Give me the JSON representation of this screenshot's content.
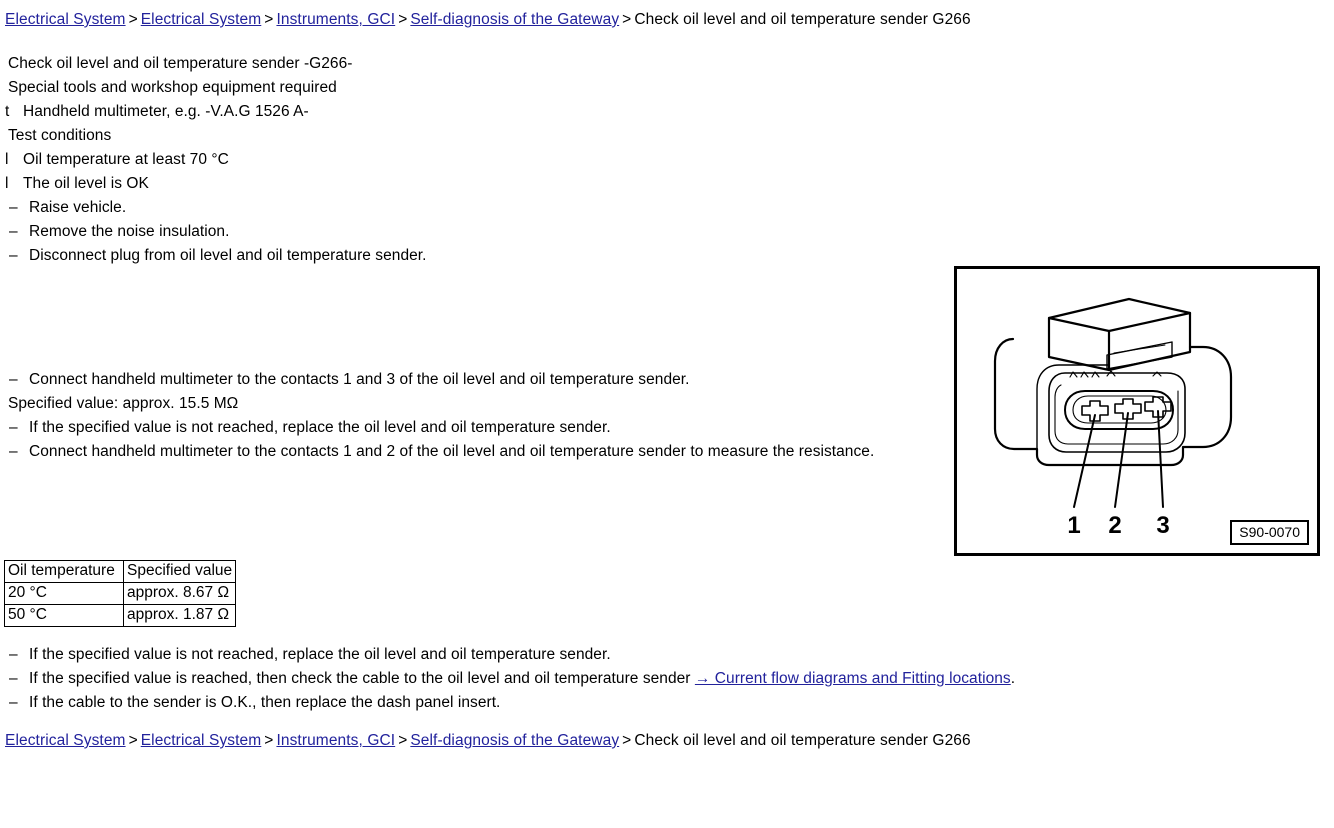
{
  "breadcrumb": {
    "links": [
      "Electrical System",
      "Electrical System",
      "Instruments, GCI",
      "Self-diagnosis of the Gateway"
    ],
    "separator": ">",
    "current": "Check oil level and oil temperature sender G266"
  },
  "content": {
    "title": "Check oil level and oil temperature sender -G266-",
    "special_tools_heading": "Special tools and workshop equipment required",
    "tool_marker": "t",
    "tool_item": "Handheld multimeter, e.g. -V.A.G 1526 A-",
    "test_conditions_heading": "Test conditions",
    "condition_marker": "l",
    "conditions": [
      "Oil temperature at least 70 °C",
      "The oil level is OK"
    ],
    "dash": "–",
    "steps": [
      "Raise vehicle.",
      "Remove the noise insulation.",
      "Disconnect plug from oil level and oil temperature sender."
    ]
  },
  "mid": {
    "step_contacts_1_3": "Connect handheld multimeter to the contacts 1 and 3 of the oil level and oil temperature sender.",
    "specified_value": "Specified value: approx. 15.5 MΩ",
    "step_not_reached": "If the specified value is not reached, replace the oil level and oil temperature sender.",
    "step_contacts_1_2": "Connect handheld multimeter to the contacts 1 and 2 of the oil level and oil temperature sender to measure the resistance."
  },
  "table": {
    "headers": [
      "Oil temperature",
      "Specified value"
    ],
    "rows": [
      [
        "20 °C",
        "approx. 8.67 Ω"
      ],
      [
        "50 °C",
        "approx. 1.87 Ω"
      ]
    ]
  },
  "bottom": {
    "line1": "If the specified value is not reached, replace the oil level and oil temperature sender.",
    "line2_prefix": "If the specified value is reached, then check the cable to the oil level and oil temperature sender ",
    "line2_link": "→ Current flow diagrams and Fitting locations",
    "line2_suffix": ".",
    "line3": "If the cable to the sender is O.K., then replace the dash panel insert."
  },
  "figure": {
    "id_label": "S90-0070",
    "contact_labels": [
      "1",
      "2",
      "3"
    ],
    "description": "Three-pin electrical connector plug with contacts numbered 1, 2 and 3"
  },
  "colors": {
    "link": "#22229c",
    "text": "#000000",
    "background": "#ffffff"
  }
}
